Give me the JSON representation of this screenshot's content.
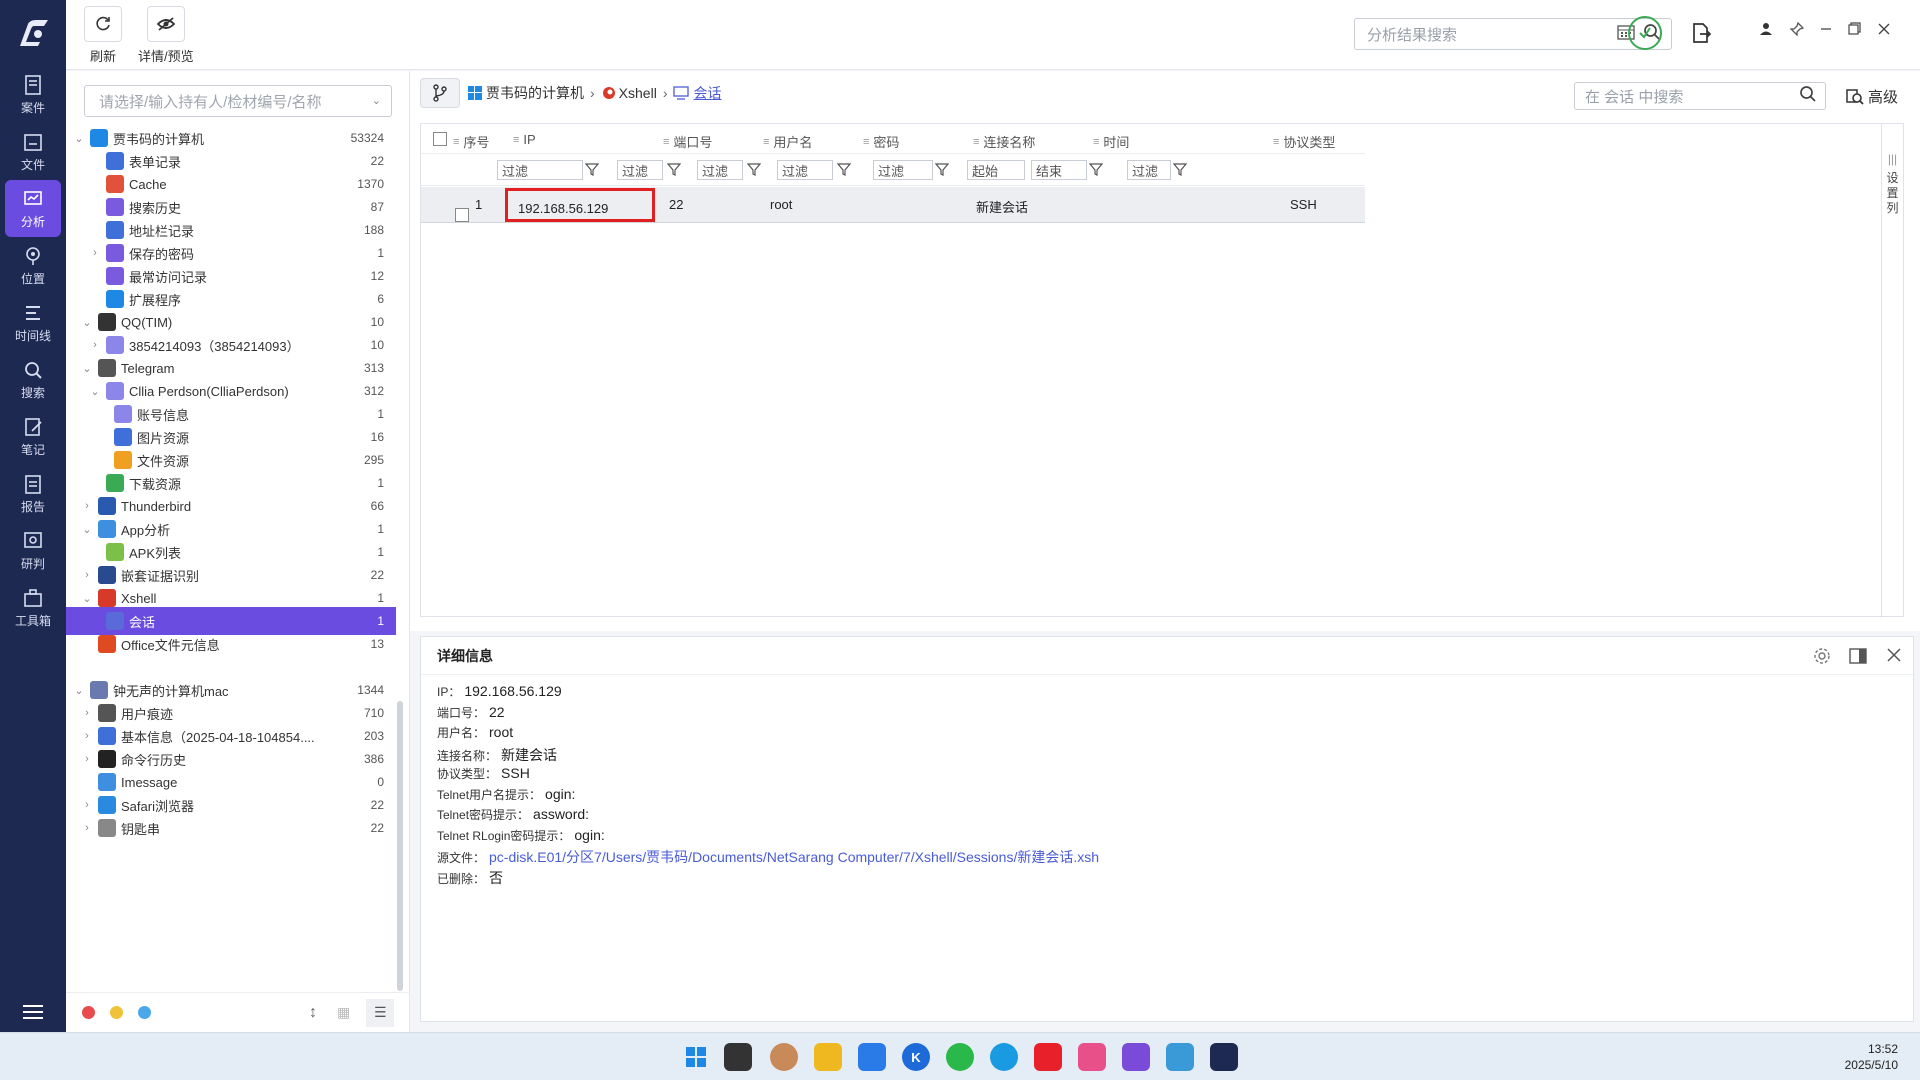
{
  "nav": [
    {
      "label": "案件",
      "icon": "case-icon"
    },
    {
      "label": "文件",
      "icon": "folder-icon"
    },
    {
      "label": "分析",
      "icon": "analysis-icon",
      "active": true
    },
    {
      "label": "位置",
      "icon": "location-icon"
    },
    {
      "label": "时间线",
      "icon": "timeline-icon"
    },
    {
      "label": "搜索",
      "icon": "search-icon"
    },
    {
      "label": "笔记",
      "icon": "note-icon"
    },
    {
      "label": "报告",
      "icon": "report-icon"
    },
    {
      "label": "研判",
      "icon": "judge-icon"
    },
    {
      "label": "工具箱",
      "icon": "toolbox-icon"
    }
  ],
  "toolbar": {
    "refresh_label": "刷新",
    "detail_label": "详情/预览",
    "search_placeholder": "分析结果搜索"
  },
  "tree": {
    "owner_placeholder": "请选择/输入持有人/检材编号/名称",
    "rows": [
      {
        "label": "贾韦码的计算机",
        "count": "53324",
        "depth": 0,
        "arrow": "v",
        "color": "#1e88e5"
      },
      {
        "label": "表单记录",
        "count": "22",
        "depth": 2,
        "arrow": "",
        "color": "#3f6fd8"
      },
      {
        "label": "Cache",
        "count": "1370",
        "depth": 2,
        "arrow": "",
        "color": "#e0523a"
      },
      {
        "label": "搜索历史",
        "count": "87",
        "depth": 2,
        "arrow": "",
        "color": "#7a5be0"
      },
      {
        "label": "地址栏记录",
        "count": "188",
        "depth": 2,
        "arrow": "",
        "color": "#3f6fd8"
      },
      {
        "label": "保存的密码",
        "count": "1",
        "depth": 2,
        "arrow": ">",
        "color": "#7a5be0"
      },
      {
        "label": "最常访问记录",
        "count": "12",
        "depth": 2,
        "arrow": "",
        "color": "#7a5be0"
      },
      {
        "label": "扩展程序",
        "count": "6",
        "depth": 2,
        "arrow": "",
        "color": "#1e88e5"
      },
      {
        "label": "QQ(TIM)",
        "count": "10",
        "depth": 1,
        "arrow": "v",
        "color": "#333333"
      },
      {
        "label": "3854214093（3854214093）",
        "count": "10",
        "depth": 2,
        "arrow": ">",
        "color": "#8c86e8"
      },
      {
        "label": "Telegram",
        "count": "313",
        "depth": 1,
        "arrow": "v",
        "color": "#555555"
      },
      {
        "label": "Cllia Perdson(ClliaPerdson)",
        "count": "312",
        "depth": 2,
        "arrow": "v",
        "color": "#8c86e8"
      },
      {
        "label": "账号信息",
        "count": "1",
        "depth": 3,
        "arrow": "",
        "color": "#8c86e8"
      },
      {
        "label": "图片资源",
        "count": "16",
        "depth": 3,
        "arrow": "",
        "color": "#3f6fd8"
      },
      {
        "label": "文件资源",
        "count": "295",
        "depth": 3,
        "arrow": "",
        "color": "#f0a020"
      },
      {
        "label": "下载资源",
        "count": "1",
        "depth": 2,
        "arrow": "",
        "color": "#3aaa55"
      },
      {
        "label": "Thunderbird",
        "count": "66",
        "depth": 1,
        "arrow": ">",
        "color": "#2a5ab0"
      },
      {
        "label": "App分析",
        "count": "1",
        "depth": 1,
        "arrow": "v",
        "color": "#3f8fe0"
      },
      {
        "label": "APK列表",
        "count": "1",
        "depth": 2,
        "arrow": "",
        "color": "#7cc04a"
      },
      {
        "label": "嵌套证据识别",
        "count": "22",
        "depth": 1,
        "arrow": ">",
        "color": "#2a4a90"
      },
      {
        "label": "Xshell",
        "count": "1",
        "depth": 1,
        "arrow": "v",
        "color": "#d83a2a"
      },
      {
        "label": "会话",
        "count": "1",
        "depth": 2,
        "arrow": "",
        "color": "#5a6ad8",
        "selected": true
      },
      {
        "label": "Office文件元信息",
        "count": "13",
        "depth": 1,
        "arrow": "",
        "color": "#e04a20"
      },
      {
        "label": "",
        "count": "",
        "depth": 0,
        "arrow": "",
        "color": ""
      },
      {
        "label": "钟无声的计算机mac",
        "count": "1344",
        "depth": 0,
        "arrow": "v",
        "color": "#6a7ab0"
      },
      {
        "label": "用户痕迹",
        "count": "710",
        "depth": 1,
        "arrow": ">",
        "color": "#555555"
      },
      {
        "label": "基本信息（2025-04-18-104854....",
        "count": "203",
        "depth": 1,
        "arrow": ">",
        "color": "#3f6fd8"
      },
      {
        "label": "命令行历史",
        "count": "386",
        "depth": 1,
        "arrow": ">",
        "color": "#222222"
      },
      {
        "label": "Imessage",
        "count": "0",
        "depth": 1,
        "arrow": "",
        "color": "#3f8fe0"
      },
      {
        "label": "Safari浏览器",
        "count": "22",
        "depth": 1,
        "arrow": ">",
        "color": "#2a8ae0"
      },
      {
        "label": "钥匙串",
        "count": "22",
        "depth": 1,
        "arrow": ">",
        "color": "#888888"
      }
    ]
  },
  "breadcrumb": [
    "贾韦码的计算机",
    "Xshell",
    "会话"
  ],
  "table_search_placeholder": "在 会话 中搜索",
  "advanced_label": "高级",
  "grid": {
    "columns": [
      "序号",
      "IP",
      "端口号",
      "用户名",
      "密码",
      "连接名称",
      "时间",
      "协议类型"
    ],
    "filter_label": "过滤",
    "time_start": "起始",
    "time_end": "结束",
    "rows": [
      {
        "index": "1",
        "ip": "192.168.56.129",
        "port": "22",
        "user": "root",
        "password": "",
        "name": "新建会话",
        "time": "",
        "protocol": "SSH"
      }
    ],
    "settings_col": [
      "设",
      "置",
      "列"
    ]
  },
  "detail": {
    "title": "详细信息",
    "fields": [
      {
        "k": "IP：",
        "v": "192.168.56.129"
      },
      {
        "k": "端口号：",
        "v": "22"
      },
      {
        "k": "用户名：",
        "v": "root"
      },
      {
        "k": "连接名称：",
        "v": "新建会话"
      },
      {
        "k": "协议类型：",
        "v": "SSH"
      },
      {
        "k": "Telnet用户名提示：",
        "v": "ogin:"
      },
      {
        "k": "Telnet密码提示：",
        "v": "assword:"
      },
      {
        "k": "Telnet RLogin密码提示：",
        "v": "ogin:"
      },
      {
        "k": "源文件：",
        "v": "pc-disk.E01/分区7/Users/贾韦码/Documents/NetSarang Computer/7/Xshell/Sessions/新建会话.xsh",
        "link": true
      },
      {
        "k": "已删除：",
        "v": "否"
      }
    ]
  },
  "clock": {
    "time": "13:52",
    "date": "2025/5/10"
  },
  "colors": {
    "nav_bg": "#1d2950",
    "accent": "#6a4de0",
    "highlight": "#e02020"
  }
}
